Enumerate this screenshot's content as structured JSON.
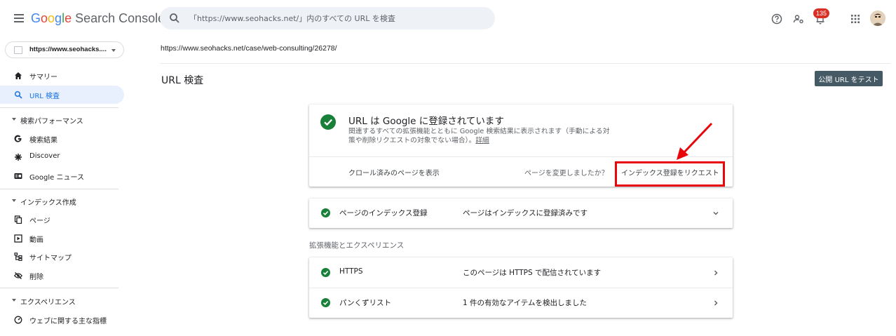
{
  "header": {
    "logo_google": [
      "G",
      "o",
      "o",
      "g",
      "l",
      "e"
    ],
    "product": "Search Console",
    "search_placeholder": "「https://www.seohacks.net/」内のすべての URL を検査",
    "notification_count": "135"
  },
  "property": {
    "label": "https://www.seohacks...."
  },
  "url": "https://www.seohacks.net/case/web-consulting/26278/",
  "sidebar": {
    "top_items": [
      {
        "label": "サマリー",
        "icon": "home-icon"
      },
      {
        "label": "URL 検査",
        "icon": "search-icon",
        "active": true
      }
    ],
    "sections": [
      {
        "title": "検索パフォーマンス",
        "items": [
          {
            "label": "検索結果",
            "icon": "google-g-icon"
          },
          {
            "label": "Discover",
            "icon": "asterisk-icon"
          },
          {
            "label": "Google ニュース",
            "icon": "news-icon"
          }
        ]
      },
      {
        "title": "インデックス作成",
        "items": [
          {
            "label": "ページ",
            "icon": "pages-icon"
          },
          {
            "label": "動画",
            "icon": "video-icon"
          },
          {
            "label": "サイトマップ",
            "icon": "sitemap-icon"
          },
          {
            "label": "削除",
            "icon": "eye-off-icon"
          }
        ]
      },
      {
        "title": "エクスペリエンス",
        "items": [
          {
            "label": "ウェブに関する主な指標",
            "icon": "gauge-icon"
          }
        ]
      }
    ]
  },
  "main": {
    "title": "URL 検査",
    "test_button": "公開 URL をテスト",
    "status": {
      "title": "URL は Google に登録されています",
      "desc": "関連するすべての拡張機能とともに Google 検索結果に表示されます（手動による対策や削除リクエストの対象でない場合）。",
      "details_link": "詳細",
      "crawled_link": "クロール済みのページを表示",
      "changed_question": "ページを変更しましたか？",
      "request_button": "インデックス登録をリクエスト"
    },
    "indexing": {
      "name": "ページのインデックス登録",
      "value": "ページはインデックスに登録済みです"
    },
    "enhancements_title": "拡張機能とエクスペリエンス",
    "enhancements": [
      {
        "name": "HTTPS",
        "value": "このページは HTTPS で配信されています"
      },
      {
        "name": "パンくずリスト",
        "value": "1 件の有効なアイテムを検出しました"
      }
    ]
  },
  "colors": {
    "accent": "#1a73e8",
    "success": "#188038",
    "highlight": "#e8060b",
    "button": "#455a64"
  }
}
